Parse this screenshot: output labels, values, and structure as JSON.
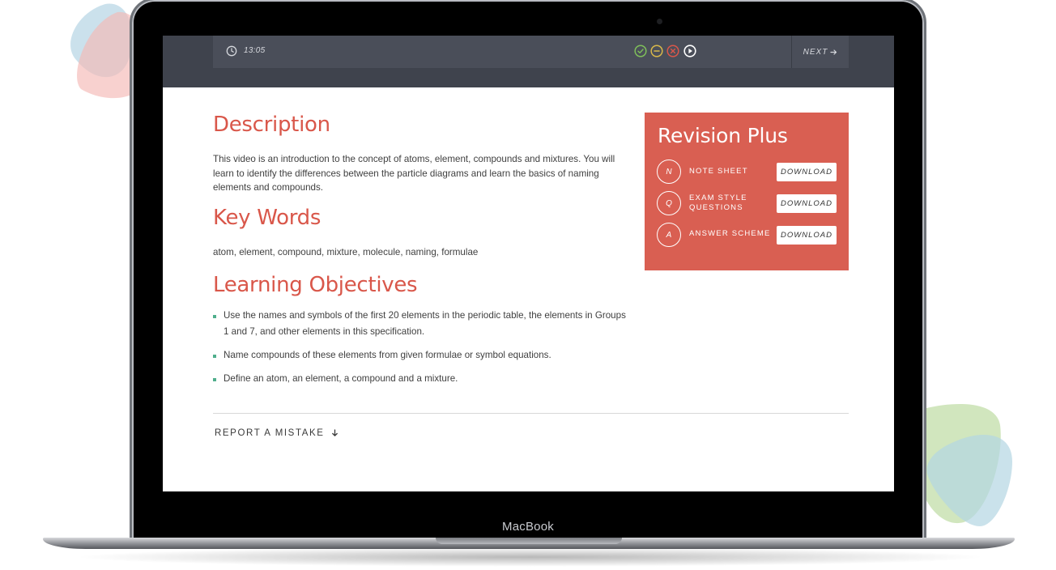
{
  "device": {
    "brand_label": "MacBook"
  },
  "player": {
    "time": "13:05",
    "next_label": "NEXT"
  },
  "description": {
    "heading": "Description",
    "text": "This video is an introduction to the concept of atoms, element, compounds and mixtures. You will learn to identify the differences between the particle diagrams and learn the basics of naming elements and compounds."
  },
  "key_words": {
    "heading": "Key Words",
    "text": "atom, element, compound, mixture, molecule, naming, formulae"
  },
  "learning_objectives": {
    "heading": "Learning Objectives",
    "items": [
      {
        "text": "Use the names and symbols of the first 20 elements in the periodic table, the elements in Groups 1 and 7, and other elements in this specification."
      },
      {
        "text": "Name compounds of these elements from given formulae or symbol equations."
      },
      {
        "text": "Define an atom, an element, a compound and a mixture."
      }
    ]
  },
  "report": {
    "label": "REPORT A MISTAKE"
  },
  "revision": {
    "title": "Revision Plus",
    "items": [
      {
        "letter": "N",
        "label": "NOTE SHEET",
        "button": "DOWNLOAD"
      },
      {
        "letter": "Q",
        "label": "EXAM STYLE QUESTIONS",
        "button": "DOWNLOAD"
      },
      {
        "letter": "A",
        "label": "ANSWER SCHEME",
        "button": "DOWNLOAD"
      }
    ]
  },
  "colors": {
    "accent": "#d9574a",
    "panel": "#d95f52",
    "bullet": "#4fae8c",
    "header": "#3f434d",
    "ctrl_done": "#7fbf5a",
    "ctrl_partial": "#d8b84a",
    "ctrl_wrong": "#d9574a"
  }
}
